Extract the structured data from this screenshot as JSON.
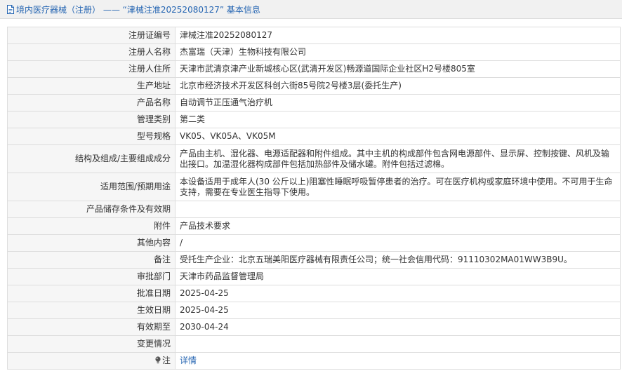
{
  "breadcrumb": {
    "section": "境内医疗器械（注册）",
    "separator": "——",
    "record": "“津械注准20252080127”",
    "suffix": "基本信息"
  },
  "fields": {
    "reg_no": {
      "label": "注册证编号",
      "value": "津械注准20252080127"
    },
    "registrant": {
      "label": "注册人名称",
      "value": "杰富瑞（天津）生物科技有限公司"
    },
    "registrant_address": {
      "label": "注册人住所",
      "value": "天津市武清京津产业新城核心区(武清开发区)畅源道国际企业社区H2号楼805室"
    },
    "production_address": {
      "label": "生产地址",
      "value": "北京市经济技术开发区科创六街85号院2号楼3层(委托生产)"
    },
    "product_name": {
      "label": "产品名称",
      "value": "自动调节正压通气治疗机"
    },
    "category": {
      "label": "管理类别",
      "value": "第二类"
    },
    "model": {
      "label": "型号规格",
      "value": "VK05、VK05A、VK05M"
    },
    "composition": {
      "label": "结构及组成/主要组成成分",
      "value": "产品由主机、湿化器、电源适配器和附件组成。其中主机的构成部件包含网电源部件、显示屏、控制按键、风机及输出接口。加温湿化器构成部件包括加热部件及储水罐。附件包括过滤棉。"
    },
    "scope": {
      "label": "适用范围/预期用途",
      "value": "本设备适用于成年人(30 公斤以上)阻塞性睡眠呼吸暂停患者的治疗。可在医疗机构或家庭环境中使用。不可用于生命支持，需要在专业医生指导下使用。"
    },
    "storage": {
      "label": "产品储存条件及有效期",
      "value": ""
    },
    "attachment": {
      "label": "附件",
      "value": "产品技术要求"
    },
    "other": {
      "label": "其他内容",
      "value": "/"
    },
    "remark": {
      "label": "备注",
      "value": "受托生产企业：北京五瑞美阳医疗器械有限责任公司；统一社会信用代码：91110302MA01WW3B9U。"
    },
    "approval_dept": {
      "label": "审批部门",
      "value": "天津市药品监督管理局"
    },
    "approval_date": {
      "label": "批准日期",
      "value": "2025-04-25"
    },
    "effective_date": {
      "label": "生效日期",
      "value": "2025-04-25"
    },
    "valid_until": {
      "label": "有效期至",
      "value": "2030-04-24"
    },
    "changes": {
      "label": "变更情况",
      "value": ""
    },
    "note": {
      "label": "注",
      "value": "详情"
    }
  },
  "icons": {
    "breadcrumb_icon": "document-icon",
    "note_icon": "lightbulb-icon"
  },
  "colors": {
    "link": "#2565b2",
    "label_bg": "#f6f6f6",
    "topbar_bg": "#f1f1f1",
    "border": "#dddddd"
  }
}
